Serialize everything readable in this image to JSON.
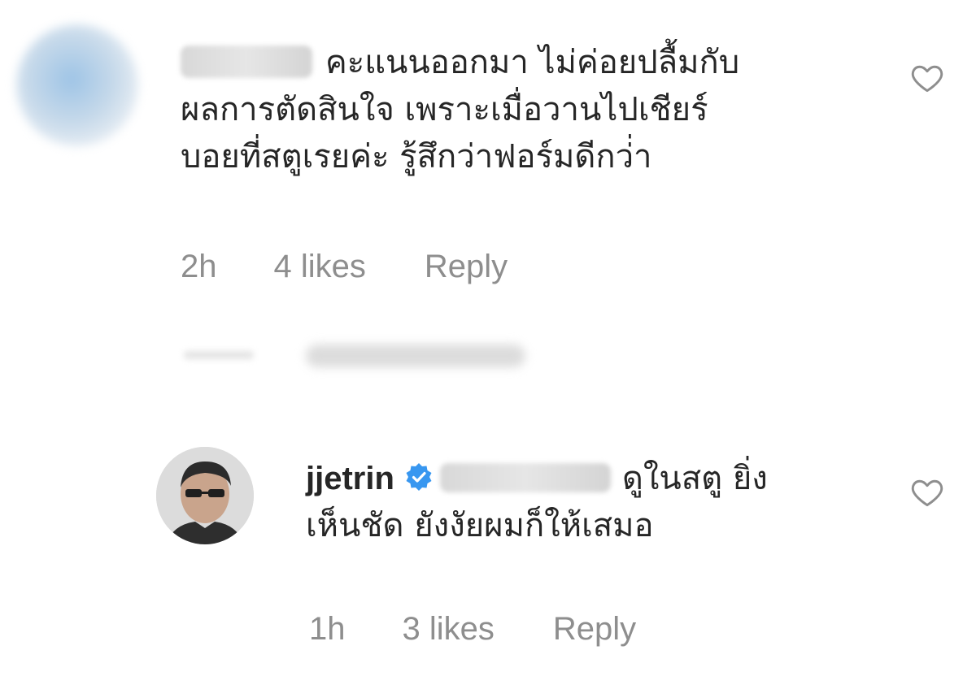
{
  "comments": [
    {
      "username": "",
      "text_line1": "คะแนนออกมา ไม่ค่อยปลื้มกับ",
      "text_line2": "ผลการตัดสินใจ เพราะเมื่อวานไปเชียร์",
      "text_line3": "บอยที่สตูเรยค่ะ รู้สึกว่าฟอร์มดีกว่่า",
      "time": "2h",
      "likes": "4 likes",
      "reply_label": "Reply"
    },
    {
      "username": "jjetrin",
      "verified": true,
      "text_line1": "ดูในสตู ยิ่ง",
      "text_line2": "เห็นชัด ยังงัยผมก็ให้เสมอ",
      "time": "1h",
      "likes": "3 likes",
      "reply_label": "Reply"
    }
  ],
  "colors": {
    "text": "#262626",
    "meta": "#8e8e8e",
    "verified_blue": "#3897f0",
    "heart_outline": "#8e8e8e"
  },
  "icons": {
    "like": "heart-outline-icon",
    "verified": "verified-badge-icon"
  }
}
